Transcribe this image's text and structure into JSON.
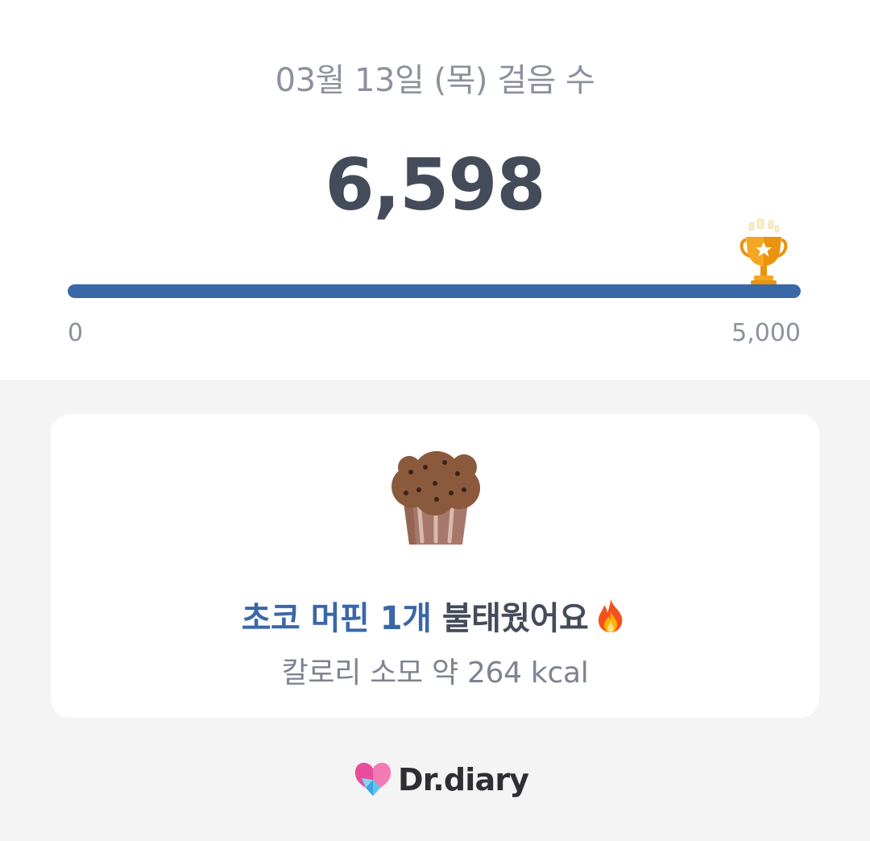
{
  "header": {
    "date_title": "03월 13일 (목) 걸음 수",
    "steps": "6,598"
  },
  "progress": {
    "min_label": "0",
    "max_label": "5,000",
    "value": 6598,
    "goal": 5000,
    "fill_fraction": 1.0,
    "goal_icon": "trophy-icon",
    "color": "#3a67a8"
  },
  "card": {
    "food_icon": "chocolate-muffin-icon",
    "burn_highlight": "초코 머핀 1개",
    "burn_suffix": "불태웠어요",
    "burn_icon": "fire-icon",
    "calorie_text": "칼로리 소모 약 264 kcal"
  },
  "footer": {
    "logo_text": "Dr.diary"
  },
  "colors": {
    "accent": "#3a67a8",
    "text_dark": "#444b59",
    "text_muted": "#8c919e"
  }
}
